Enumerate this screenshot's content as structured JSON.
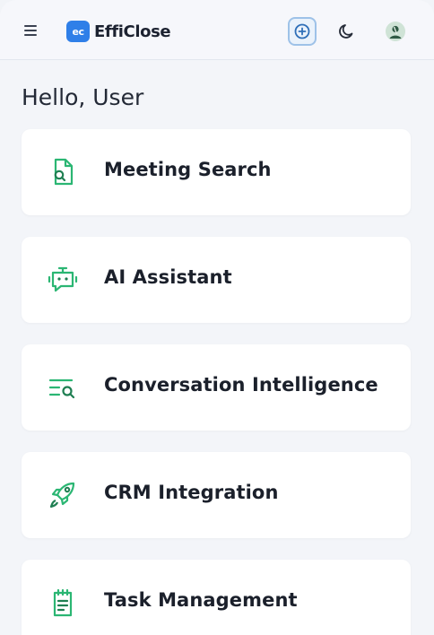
{
  "header": {
    "logo_mark": "ec",
    "logo_text": "EffiClose",
    "menu_icon": "hamburger-menu-icon",
    "new_button_icon": "plus-circle-icon",
    "theme_icon": "moon-icon",
    "avatar_icon": "user-avatar"
  },
  "greeting": "Hello, User",
  "accent_color": "#2bb673",
  "brand_color": "#2f7fe8",
  "cards": [
    {
      "label": "Meeting Search",
      "icon": "document-search-icon"
    },
    {
      "label": "AI Assistant",
      "icon": "robot-chat-icon"
    },
    {
      "label": "Conversation Intelligence",
      "icon": "list-search-icon"
    },
    {
      "label": "CRM Integration",
      "icon": "rocket-icon"
    },
    {
      "label": "Task Management",
      "icon": "clipboard-list-icon"
    }
  ]
}
